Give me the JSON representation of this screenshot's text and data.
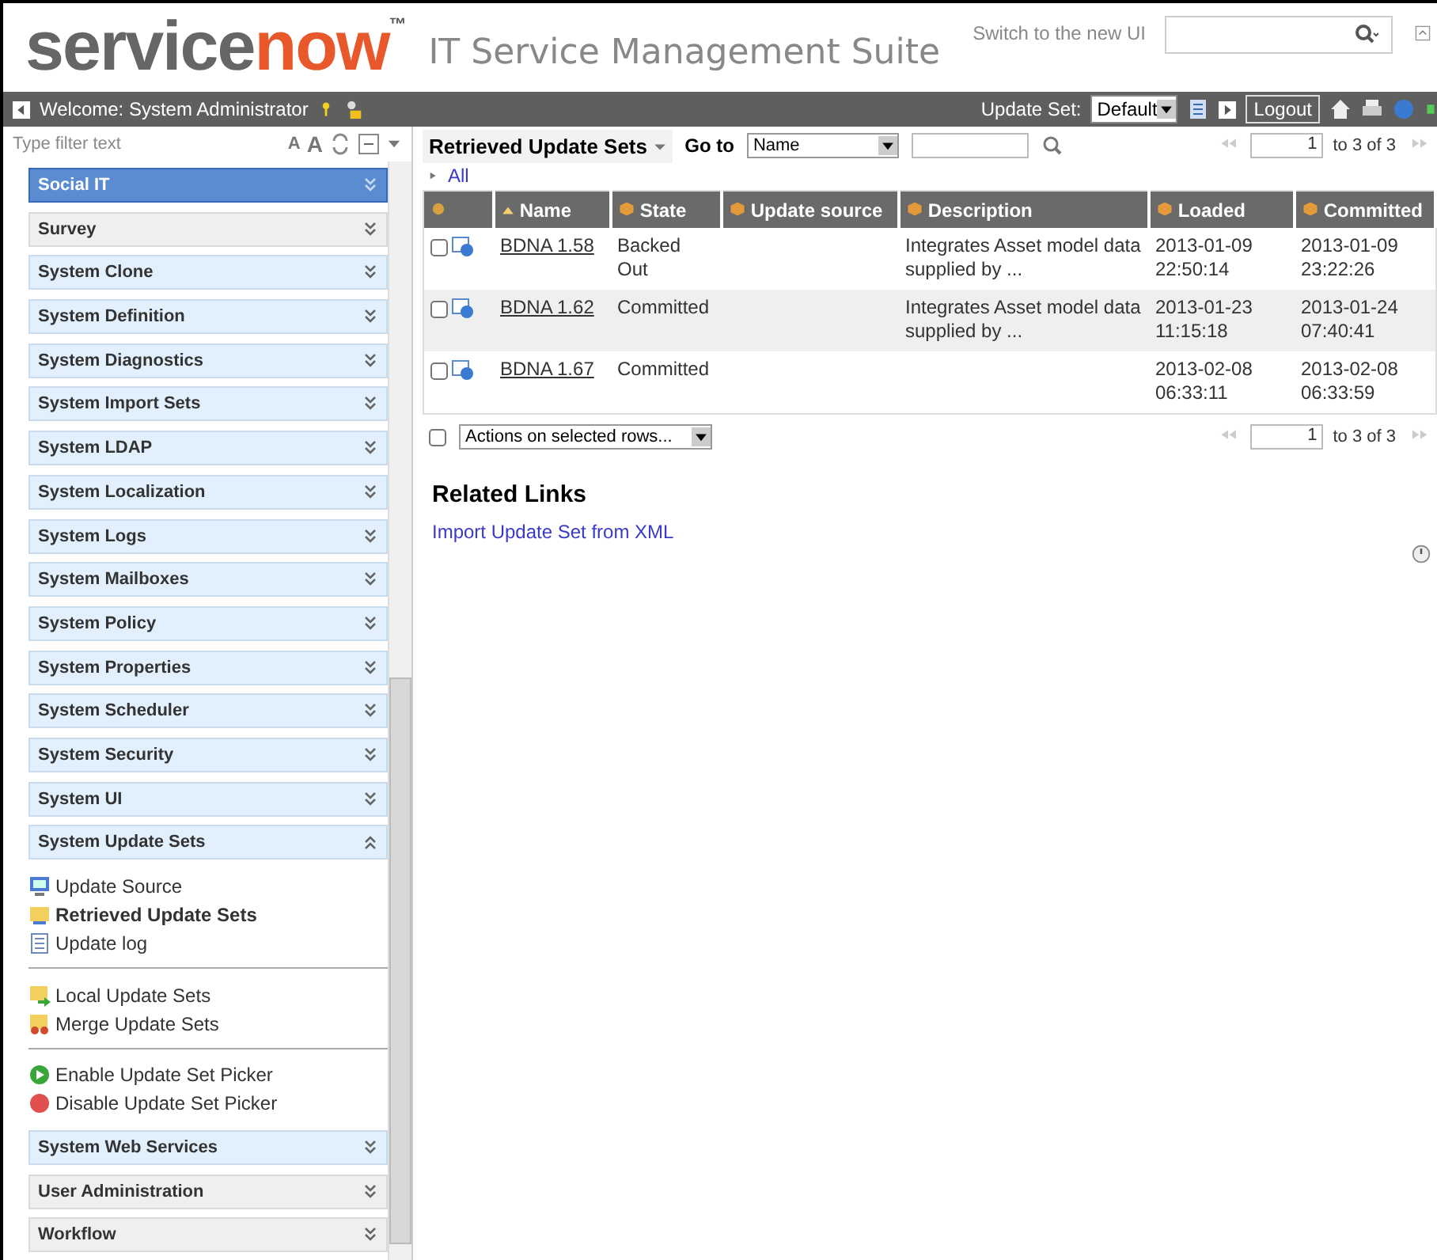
{
  "header": {
    "logo": {
      "main": "service",
      "accent": "now",
      "mark": "™"
    },
    "suite_title": "IT Service Management Suite",
    "switch_ui": "Switch to the new UI"
  },
  "top_bar": {
    "welcome": "Welcome: System Administrator",
    "update_set_label": "Update Set:",
    "update_set_value": "Default",
    "logout": "Logout"
  },
  "sidebar": {
    "filter": {
      "placeholder": "Type filter text"
    },
    "font_small": "A",
    "font_large": "A",
    "sections": [
      {
        "label": "Social IT",
        "selected": true,
        "highlighted": true,
        "expanded": false
      },
      {
        "label": "Survey",
        "selected": false,
        "highlighted": false,
        "expanded": false
      },
      {
        "label": "System Clone",
        "selected": false,
        "highlighted": true,
        "expanded": false
      },
      {
        "label": "System Definition",
        "selected": false,
        "highlighted": true,
        "expanded": false
      },
      {
        "label": "System Diagnostics",
        "selected": false,
        "highlighted": true,
        "expanded": false
      },
      {
        "label": "System Import Sets",
        "selected": false,
        "highlighted": true,
        "expanded": false
      },
      {
        "label": "System LDAP",
        "selected": false,
        "highlighted": true,
        "expanded": false
      },
      {
        "label": "System Localization",
        "selected": false,
        "highlighted": true,
        "expanded": false
      },
      {
        "label": "System Logs",
        "selected": false,
        "highlighted": true,
        "expanded": false
      },
      {
        "label": "System Mailboxes",
        "selected": false,
        "highlighted": true,
        "expanded": false
      },
      {
        "label": "System Policy",
        "selected": false,
        "highlighted": true,
        "expanded": false
      },
      {
        "label": "System Properties",
        "selected": false,
        "highlighted": true,
        "expanded": false
      },
      {
        "label": "System Scheduler",
        "selected": false,
        "highlighted": true,
        "expanded": false
      },
      {
        "label": "System Security",
        "selected": false,
        "highlighted": true,
        "expanded": false
      },
      {
        "label": "System UI",
        "selected": false,
        "highlighted": true,
        "expanded": false
      },
      {
        "label": "System Update Sets",
        "selected": false,
        "highlighted": true,
        "expanded": true,
        "groups": [
          {
            "modules": [
              {
                "label": "Update Source",
                "kind": "monitor",
                "selected": false
              },
              {
                "label": "Retrieved Update Sets",
                "kind": "folder",
                "selected": true
              },
              {
                "label": "Update log",
                "kind": "list",
                "selected": false
              }
            ]
          },
          {
            "modules": [
              {
                "label": "Local Update Sets",
                "kind": "folder-arrow",
                "selected": false
              },
              {
                "label": "Merge Update Sets",
                "kind": "folder-merge",
                "selected": false
              }
            ]
          },
          {
            "modules": [
              {
                "label": "Enable Update Set Picker",
                "kind": "play",
                "selected": false
              },
              {
                "label": "Disable Update Set Picker",
                "kind": "stop",
                "selected": false
              }
            ]
          }
        ]
      },
      {
        "label": "System Web Services",
        "selected": false,
        "highlighted": true,
        "expanded": false
      },
      {
        "label": "User Administration",
        "selected": false,
        "highlighted": false,
        "expanded": false
      },
      {
        "label": "Workflow",
        "selected": false,
        "highlighted": false,
        "expanded": false
      }
    ]
  },
  "list": {
    "title": "Retrieved Update Sets",
    "goto_label": "Go to",
    "goto_field": "Name",
    "page_start": "1",
    "page_range": "to 3 of 3",
    "breadcrumb": "All",
    "columns": [
      {
        "label": "Name",
        "sorted": true
      },
      {
        "label": "State",
        "sorted": false
      },
      {
        "label": "Update source",
        "sorted": false
      },
      {
        "label": "Description",
        "sorted": false
      },
      {
        "label": "Loaded",
        "sorted": false
      },
      {
        "label": "Committed",
        "sorted": false
      }
    ],
    "select_all_checked": false,
    "rows": [
      {
        "checked": false,
        "name": "BDNA 1.58",
        "state": "Backed Out",
        "description": "Integrates Asset model data supplied by ...",
        "loaded": "2013-01-09 22:50:14",
        "committed": "2013-01-09 23:22:26"
      },
      {
        "checked": false,
        "name": "BDNA 1.62",
        "state": "Committed",
        "description": "Integrates Asset model data supplied by ...",
        "loaded": "2013-01-23 11:15:18",
        "committed": "2013-01-24 07:40:41"
      },
      {
        "checked": false,
        "name": "BDNA 1.67",
        "state": "Committed",
        "loaded": "2013-02-08 06:33:11",
        "committed": "2013-02-08 06:33:59"
      }
    ],
    "actions": "Actions on selected rows...",
    "footer_page_start": "1",
    "footer_page_range": "to 3 of 3"
  },
  "related_links": {
    "title": "Related Links",
    "links": [
      "Import Update Set from XML"
    ]
  }
}
